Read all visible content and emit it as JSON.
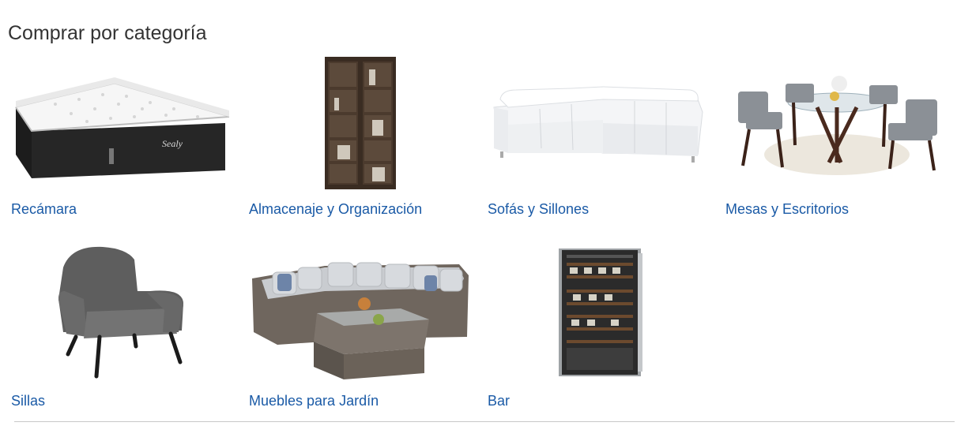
{
  "section": {
    "title": "Comprar por categoría"
  },
  "categories": [
    {
      "label": "Recámara",
      "icon": "mattress-image"
    },
    {
      "label": "Almacenaje y Organización",
      "icon": "bookcase-image"
    },
    {
      "label": "Sofás y Sillones",
      "icon": "sectional-sofa-image"
    },
    {
      "label": "Mesas y Escritorios",
      "icon": "dining-set-image"
    },
    {
      "label": "Sillas",
      "icon": "armchair-image"
    },
    {
      "label": "Muebles para Jardín",
      "icon": "patio-set-image"
    },
    {
      "label": "Bar",
      "icon": "wine-cooler-image"
    }
  ],
  "colors": {
    "link": "#1a5aa6",
    "title": "#333333",
    "divider": "#c8c8c8"
  }
}
